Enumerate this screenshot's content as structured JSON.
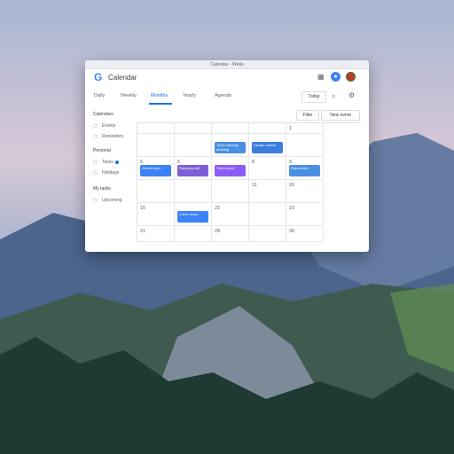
{
  "window": {
    "title": "Calendar - Week"
  },
  "app": {
    "title": "Calendar",
    "logo": "G"
  },
  "header_icons": {
    "apps": "apps-grid-icon",
    "help": "help-icon",
    "avatar": "avatar"
  },
  "tabs": [
    {
      "label": "Daily"
    },
    {
      "label": "Weekly"
    },
    {
      "label": "Monthly",
      "active": true
    },
    {
      "label": "Yearly"
    },
    {
      "label": "Agenda"
    }
  ],
  "toolbar": {
    "today_label": "Today",
    "filter_label": "Filter",
    "new_event_label": "New event"
  },
  "sidebar": {
    "section1": {
      "title": "Calendars",
      "items": [
        {
          "label": "Events"
        },
        {
          "label": "Reminders"
        }
      ]
    },
    "section2": {
      "title": "Personal",
      "items": [
        {
          "label": "Tasks"
        },
        {
          "label": "Holidays"
        }
      ]
    },
    "section3": {
      "title": "My tasks",
      "items": [
        {
          "label": "Upcoming"
        }
      ]
    }
  },
  "calendar": {
    "days": [
      "",
      "",
      "",
      "",
      "1",
      "",
      "",
      "",
      "",
      "",
      "5",
      "6",
      "",
      "8",
      "9",
      "",
      "",
      "",
      "11",
      "20",
      "15",
      "",
      "22",
      "",
      "23",
      "21",
      "",
      "28",
      "",
      "30"
    ],
    "events": [
      {
        "cell": 7,
        "label": "Team standup meeting",
        "color": "#4a90e2"
      },
      {
        "cell": 8,
        "label": "Design review",
        "color": "#3b7ddd"
      },
      {
        "cell": 10,
        "label": "Kickoff sync",
        "color": "#3b82f6"
      },
      {
        "cell": 11,
        "label": "Planning call",
        "color": "#7c5fd6"
      },
      {
        "cell": 12,
        "label": "Team lunch",
        "color": "#8b5cf6"
      },
      {
        "cell": 14,
        "label": "Report due",
        "color": "#4a90e2"
      },
      {
        "cell": 21,
        "label": "Client demo",
        "color": "#3b82f6"
      }
    ]
  },
  "colors": {
    "accent": "#1a73e8"
  }
}
